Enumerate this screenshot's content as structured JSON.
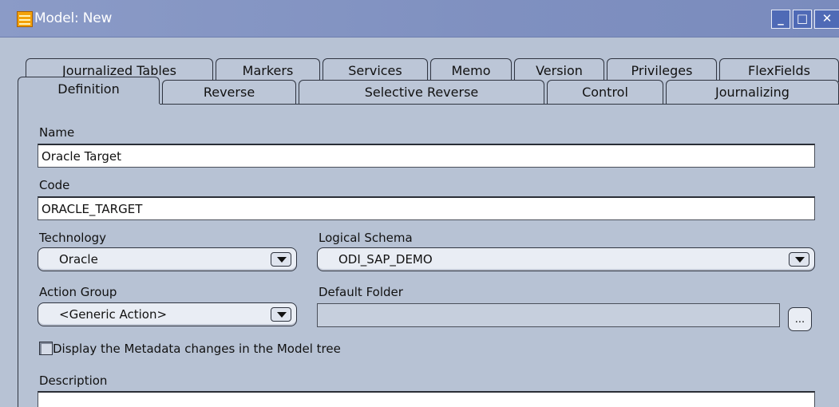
{
  "window": {
    "title": "Model: New",
    "minimize_glyph": "_",
    "maximize_glyph": "□",
    "close_glyph": "✕"
  },
  "tabs_row1": [
    "Journalized Tables",
    "Markers",
    "Services",
    "Memo",
    "Version",
    "Privileges",
    "FlexFields"
  ],
  "tabs_row2": [
    "Definition",
    "Reverse",
    "Selective Reverse",
    "Control",
    "Journalizing"
  ],
  "active_tab": "Definition",
  "form": {
    "name_label": "Name",
    "name_value": "Oracle Target",
    "code_label": "Code",
    "code_value": "ORACLE_TARGET",
    "technology_label": "Technology",
    "technology_value": "Oracle",
    "logical_schema_label": "Logical Schema",
    "logical_schema_value": "ODI_SAP_DEMO",
    "action_group_label": "Action Group",
    "action_group_value": "<Generic Action>",
    "default_folder_label": "Default Folder",
    "default_folder_value": "",
    "browse_label": "...",
    "display_metadata_label": "Display the Metadata changes in the Model tree",
    "display_metadata_checked": false,
    "description_label": "Description",
    "description_value": ""
  },
  "colors": {
    "titlebar": "#7f90c0",
    "panel": "#b7c2d4",
    "field_bg": "#ffffff"
  }
}
